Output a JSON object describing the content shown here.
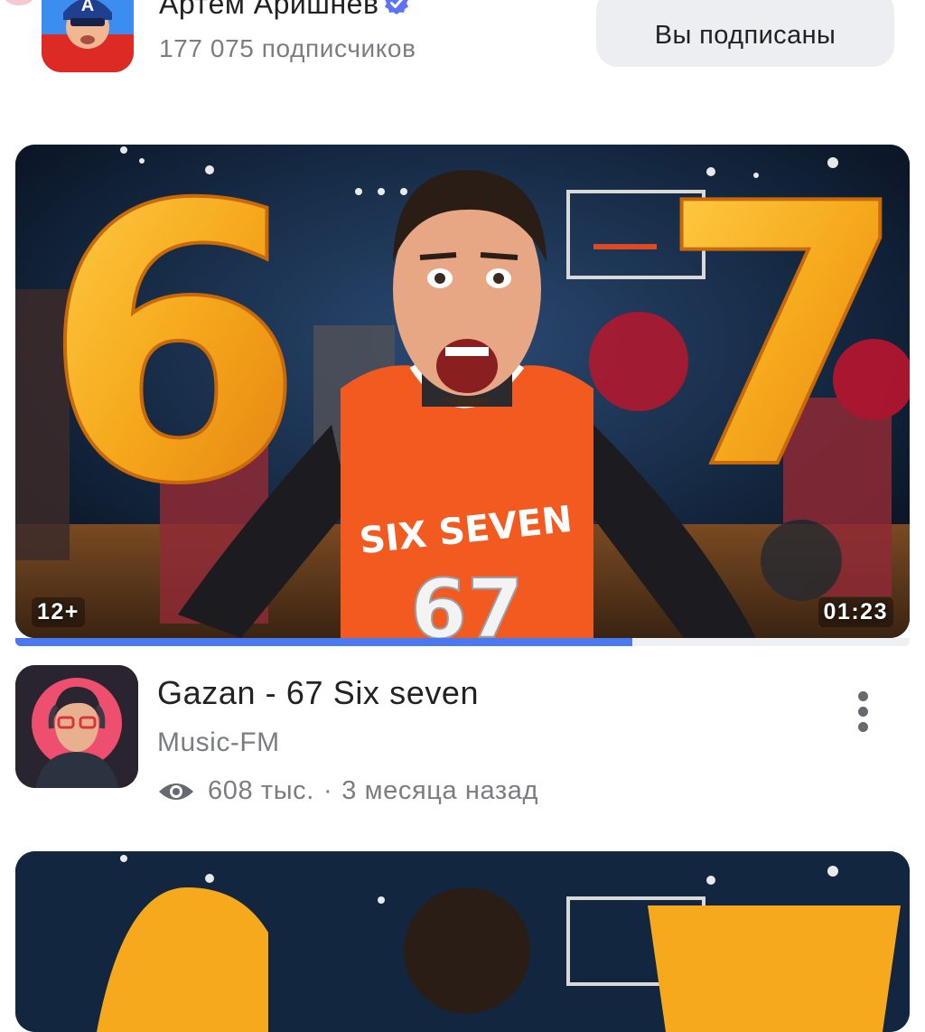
{
  "channel": {
    "name": "Артём Аришнев",
    "subscribers": "177 075 подписчиков",
    "subscribe_button": "Вы подписаны",
    "verified_icon": "verified-check-icon"
  },
  "video": {
    "title": "Gazan - 67 Six seven",
    "author": "Music-FM",
    "views": "608 тыс.",
    "separator": "·",
    "published": "3 месяца назад",
    "age_rating": "12+",
    "duration": "01:23",
    "watched_fraction": 0.69,
    "thumbnail_numbers": [
      "6",
      "7"
    ],
    "jersey_text": "SIX SEVEN",
    "jersey_number": "67",
    "more_icon": "more-vertical-icon",
    "views_icon": "eye-icon"
  },
  "colors": {
    "accent": "#4a78f0",
    "button_bg": "#eceef1",
    "secondary_text": "#7b7d83",
    "number_gold": "#f6a91c",
    "jersey_orange": "#f25a1f"
  }
}
